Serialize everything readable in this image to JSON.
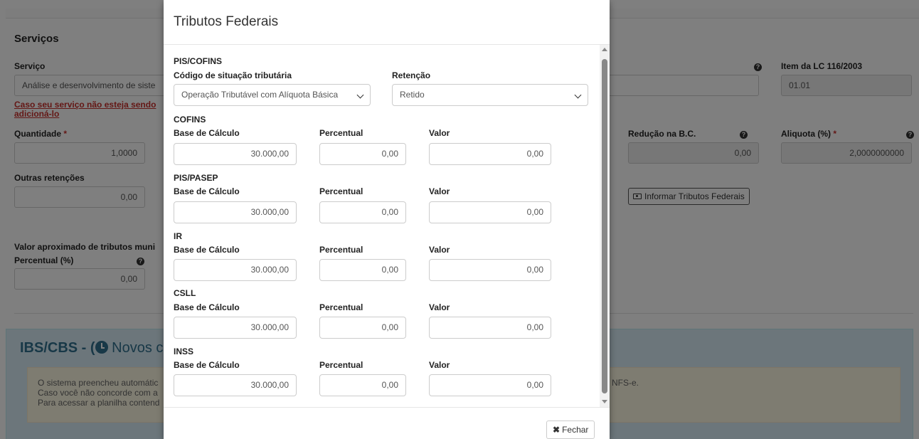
{
  "background": {
    "section_title": "Serviços",
    "servico_label": "Serviço",
    "servico_value": "Análise e desenvolvimento de siste",
    "item_lc_label": "Item da LC 116/2003",
    "item_lc_value": "01.01",
    "link_line1": "Caso seu serviço não esteja sendo",
    "link_line2": "adicioná-lo",
    "quantidade_label": "Quantidade",
    "quantidade_value": "1,0000",
    "reducao_label": "Redução na B.C.",
    "reducao_value": "0,00",
    "aliquota_label": "Aliquota (%)",
    "aliquota_value": "2,0000000000",
    "outras_label": "Outras retenções",
    "outras_value": "0,00",
    "informar_button": "Informar Tributos Federais",
    "aprox_label": "Valor aproximado de tributos muni",
    "percentual_label": "Percentual (%)",
    "percentual_value": "0,00",
    "required_mark": "*",
    "ibs_title": "IBS/CBS - (",
    "ibs_title_light": "Novos c",
    "warn_line1": "O sistema preencheu automátic",
    "warn_line2": "Caso você não concorde com a",
    "warn_line3": "Para acessar a planilha contend",
    "warn_suffix": "NFS-e."
  },
  "modal": {
    "title": "Tributos Federais",
    "close_label": "Fechar",
    "pis_cofins": {
      "title": "PIS/COFINS",
      "cst_label": "Código de situação tributária",
      "cst_value": "Operação Tributável com Alíquota Básica",
      "retencao_label": "Retenção",
      "retencao_value": "Retido"
    },
    "col_labels": {
      "base": "Base de Cálculo",
      "percentual": "Percentual",
      "valor": "Valor"
    },
    "groups": [
      {
        "title": "COFINS",
        "base": "30.000,00",
        "percentual": "0,00",
        "valor": "0,00"
      },
      {
        "title": "PIS/PASEP",
        "base": "30.000,00",
        "percentual": "0,00",
        "valor": "0,00"
      },
      {
        "title": "IR",
        "base": "30.000,00",
        "percentual": "0,00",
        "valor": "0,00"
      },
      {
        "title": "CSLL",
        "base": "30.000,00",
        "percentual": "0,00",
        "valor": "0,00"
      },
      {
        "title": "INSS",
        "base": "30.000,00",
        "percentual": "0,00",
        "valor": "0,00"
      }
    ]
  },
  "colors": {
    "overlay": "rgba(0,0,0,0.5)",
    "required": "#c9302c",
    "info_panel": "#d9edf7",
    "warning_panel": "#fcf8e3"
  },
  "icons": {
    "help": "question-circle-icon",
    "money": "money-icon",
    "clock": "clock-icon",
    "close": "times-icon"
  }
}
